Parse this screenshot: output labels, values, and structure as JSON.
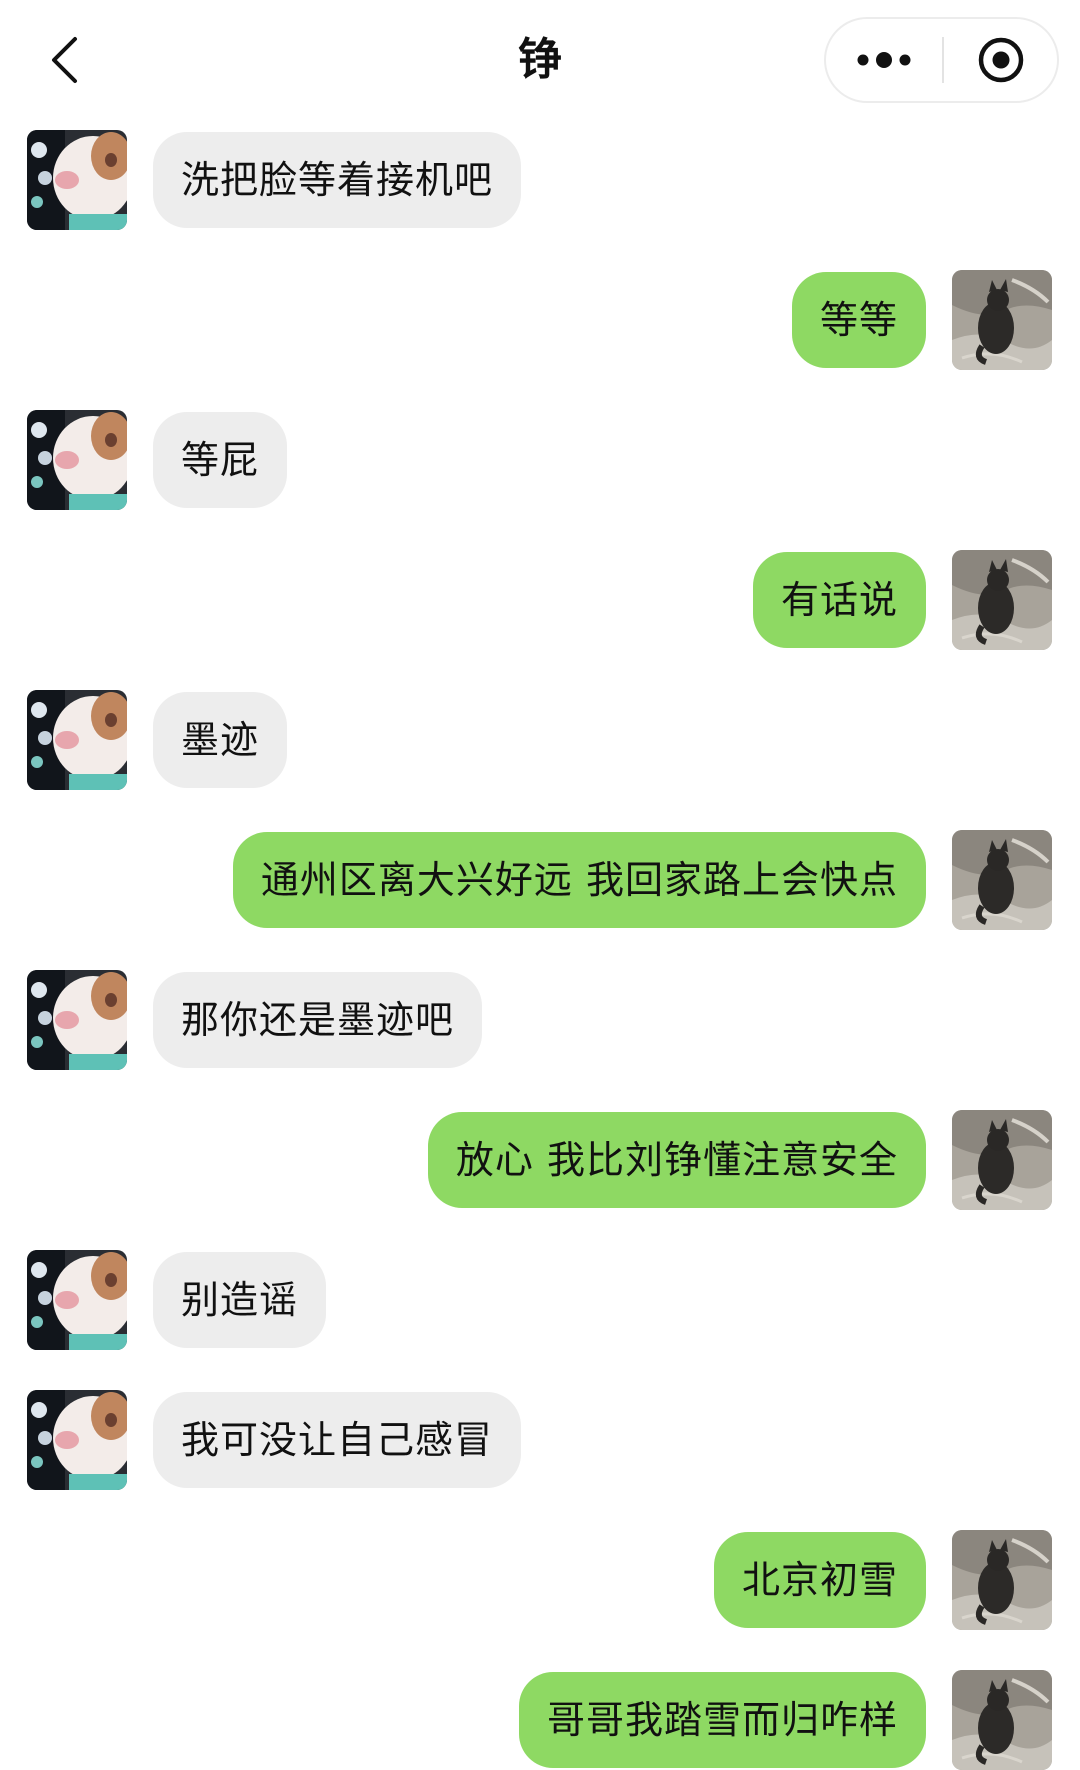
{
  "header": {
    "title": "铮",
    "back_icon": "chevron-left-icon",
    "more_icon": "more-dots-icon",
    "close_icon": "target-circle-icon"
  },
  "colors": {
    "incoming_bubble": "#ededed",
    "outgoing_bubble": "#8ed963",
    "background": "#ffffff"
  },
  "messages": [
    {
      "side": "left",
      "text": "洗把脸等着接机吧"
    },
    {
      "side": "right",
      "text": "等等"
    },
    {
      "side": "left",
      "text": "等屁"
    },
    {
      "side": "right",
      "text": "有话说"
    },
    {
      "side": "left",
      "text": "墨迹"
    },
    {
      "side": "right",
      "text": "通州区离大兴好远 我回家路上会快点"
    },
    {
      "side": "left",
      "text": "那你还是墨迹吧"
    },
    {
      "side": "right",
      "text": "放心 我比刘铮懂注意安全"
    },
    {
      "side": "left",
      "text": "别造谣"
    },
    {
      "side": "left",
      "text": "我可没让自己感冒"
    },
    {
      "side": "right",
      "text": "北京初雪"
    },
    {
      "side": "right",
      "text": "哥哥我踏雪而归咋样"
    }
  ]
}
